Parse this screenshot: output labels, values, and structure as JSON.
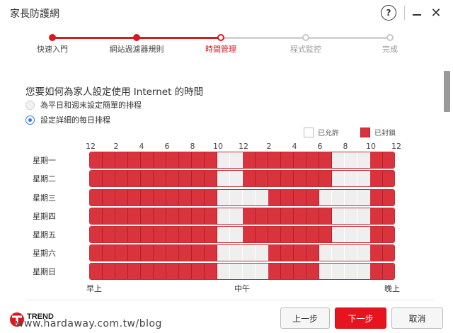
{
  "window": {
    "title": "家長防護網"
  },
  "wizard": {
    "steps": [
      {
        "label": "快速入門",
        "state": "done"
      },
      {
        "label": "網站過濾器規則",
        "state": "done"
      },
      {
        "label": "時間管理",
        "state": "current"
      },
      {
        "label": "程式監控",
        "state": "todo"
      },
      {
        "label": "完成",
        "state": "todo"
      }
    ]
  },
  "main": {
    "question": "您要如何為家人設定使用 Internet 的時間",
    "options": [
      {
        "label": "為平日和週末設定簡單的排程",
        "selected": false
      },
      {
        "label": "設定詳細的每日排程",
        "selected": true
      }
    ]
  },
  "legend": {
    "allowed": "已允許",
    "blocked": "已封鎖"
  },
  "schedule": {
    "hour_labels": [
      "12",
      "2",
      "4",
      "6",
      "8",
      "10",
      "12",
      "2",
      "4",
      "6",
      "8",
      "10",
      "12"
    ],
    "axis": {
      "left": "早上",
      "middle": "中午",
      "right": "晚上"
    },
    "days": [
      {
        "label": "星期一",
        "blocked": [
          1,
          1,
          1,
          1,
          1,
          1,
          1,
          1,
          1,
          1,
          0,
          0,
          1,
          1,
          1,
          1,
          1,
          1,
          1,
          0,
          0,
          0,
          1,
          1
        ]
      },
      {
        "label": "星期二",
        "blocked": [
          1,
          1,
          1,
          1,
          1,
          1,
          1,
          1,
          1,
          1,
          0,
          0,
          1,
          1,
          1,
          1,
          1,
          1,
          1,
          0,
          0,
          0,
          1,
          1
        ]
      },
      {
        "label": "星期三",
        "blocked": [
          1,
          1,
          1,
          1,
          1,
          1,
          1,
          1,
          1,
          1,
          0,
          0,
          0,
          0,
          1,
          1,
          1,
          1,
          0,
          0,
          0,
          0,
          1,
          1
        ]
      },
      {
        "label": "星期四",
        "blocked": [
          1,
          1,
          1,
          1,
          1,
          1,
          1,
          1,
          1,
          1,
          0,
          0,
          1,
          1,
          1,
          1,
          1,
          1,
          1,
          0,
          0,
          0,
          1,
          1
        ]
      },
      {
        "label": "星期五",
        "blocked": [
          1,
          1,
          1,
          1,
          1,
          1,
          1,
          1,
          1,
          1,
          0,
          0,
          1,
          1,
          1,
          1,
          1,
          1,
          1,
          0,
          0,
          0,
          1,
          1
        ]
      },
      {
        "label": "星期六",
        "blocked": [
          1,
          1,
          1,
          1,
          1,
          1,
          1,
          1,
          1,
          1,
          0,
          0,
          0,
          0,
          1,
          1,
          1,
          1,
          0,
          0,
          0,
          0,
          1,
          1
        ]
      },
      {
        "label": "星期日",
        "blocked": [
          1,
          1,
          1,
          1,
          1,
          1,
          1,
          1,
          1,
          1,
          0,
          0,
          0,
          0,
          1,
          1,
          1,
          1,
          0,
          0,
          0,
          0,
          1,
          1
        ]
      }
    ]
  },
  "footer": {
    "brand": "TREND",
    "watermark": "www.hardaway.com.tw/blog",
    "prev_label": "上一步",
    "next_label": "下一步",
    "cancel_label": "取消"
  },
  "colors": {
    "accent": "#d71920",
    "blocked": "#d9343e",
    "allowed": "#efefef",
    "radio": "#2b7de9"
  }
}
